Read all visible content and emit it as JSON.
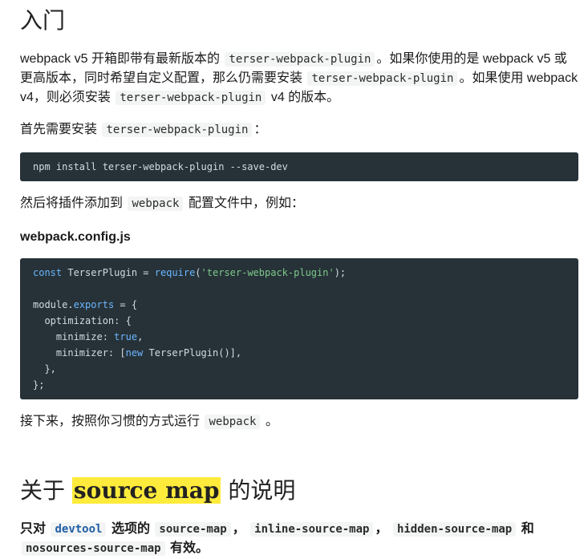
{
  "intro": {
    "heading": "入门",
    "para1": {
      "a": "webpack v5 开箱即带有最新版本的",
      "code1": "terser-webpack-plugin",
      "b": "。如果你使用的是 webpack v5 或更高版本，同时希望自定义配置，那么仍需要安装",
      "code2": "terser-webpack-plugin",
      "c": "。如果使用 webpack v4，则必须安装",
      "code3": "terser-webpack-plugin",
      "d": "v4 的版本。"
    },
    "para2": {
      "a": "首先需要安装",
      "code": "terser-webpack-plugin",
      "b": "："
    },
    "install_cmd": "npm install terser-webpack-plugin --save-dev",
    "para3": {
      "a": "然后将插件添加到",
      "code": "webpack",
      "b": "配置文件中，例如："
    },
    "config_caption": "webpack.config.js",
    "config_code": {
      "l1_kw": "const",
      "l1_name": " TerserPlugin = ",
      "l1_fn": "require",
      "l1_p1": "(",
      "l1_str": "'terser-webpack-plugin'",
      "l1_p2": ");",
      "l3_a": "module",
      "l3_b": ".",
      "l3_c": "exports",
      "l3_d": " = {",
      "l4_prop": "  optimization",
      "l4_rest": ": {",
      "l5_prop": "    minimize",
      "l5_colon": ": ",
      "l5_val": "true",
      "l5_end": ",",
      "l6_prop": "    minimizer",
      "l6_colon": ": [",
      "l6_kw": "new",
      "l6_rest": " TerserPlugin()],",
      "l7": "  },",
      "l8": "};"
    },
    "para4": {
      "a": "接下来，按照你习惯的方式运行",
      "code": "webpack",
      "b": "。"
    }
  },
  "source_map": {
    "heading_a": "关于",
    "heading_hl": "source map",
    "heading_b": "的说明",
    "para": {
      "a": "只对",
      "code1": "devtool",
      "b": "选项的",
      "code2": "source-map",
      "c": "，",
      "code3": "inline-source-map",
      "d": "，",
      "code4": "hidden-source-map",
      "e": "和",
      "code5": "nosources-source-map",
      "f": "有效。"
    }
  }
}
